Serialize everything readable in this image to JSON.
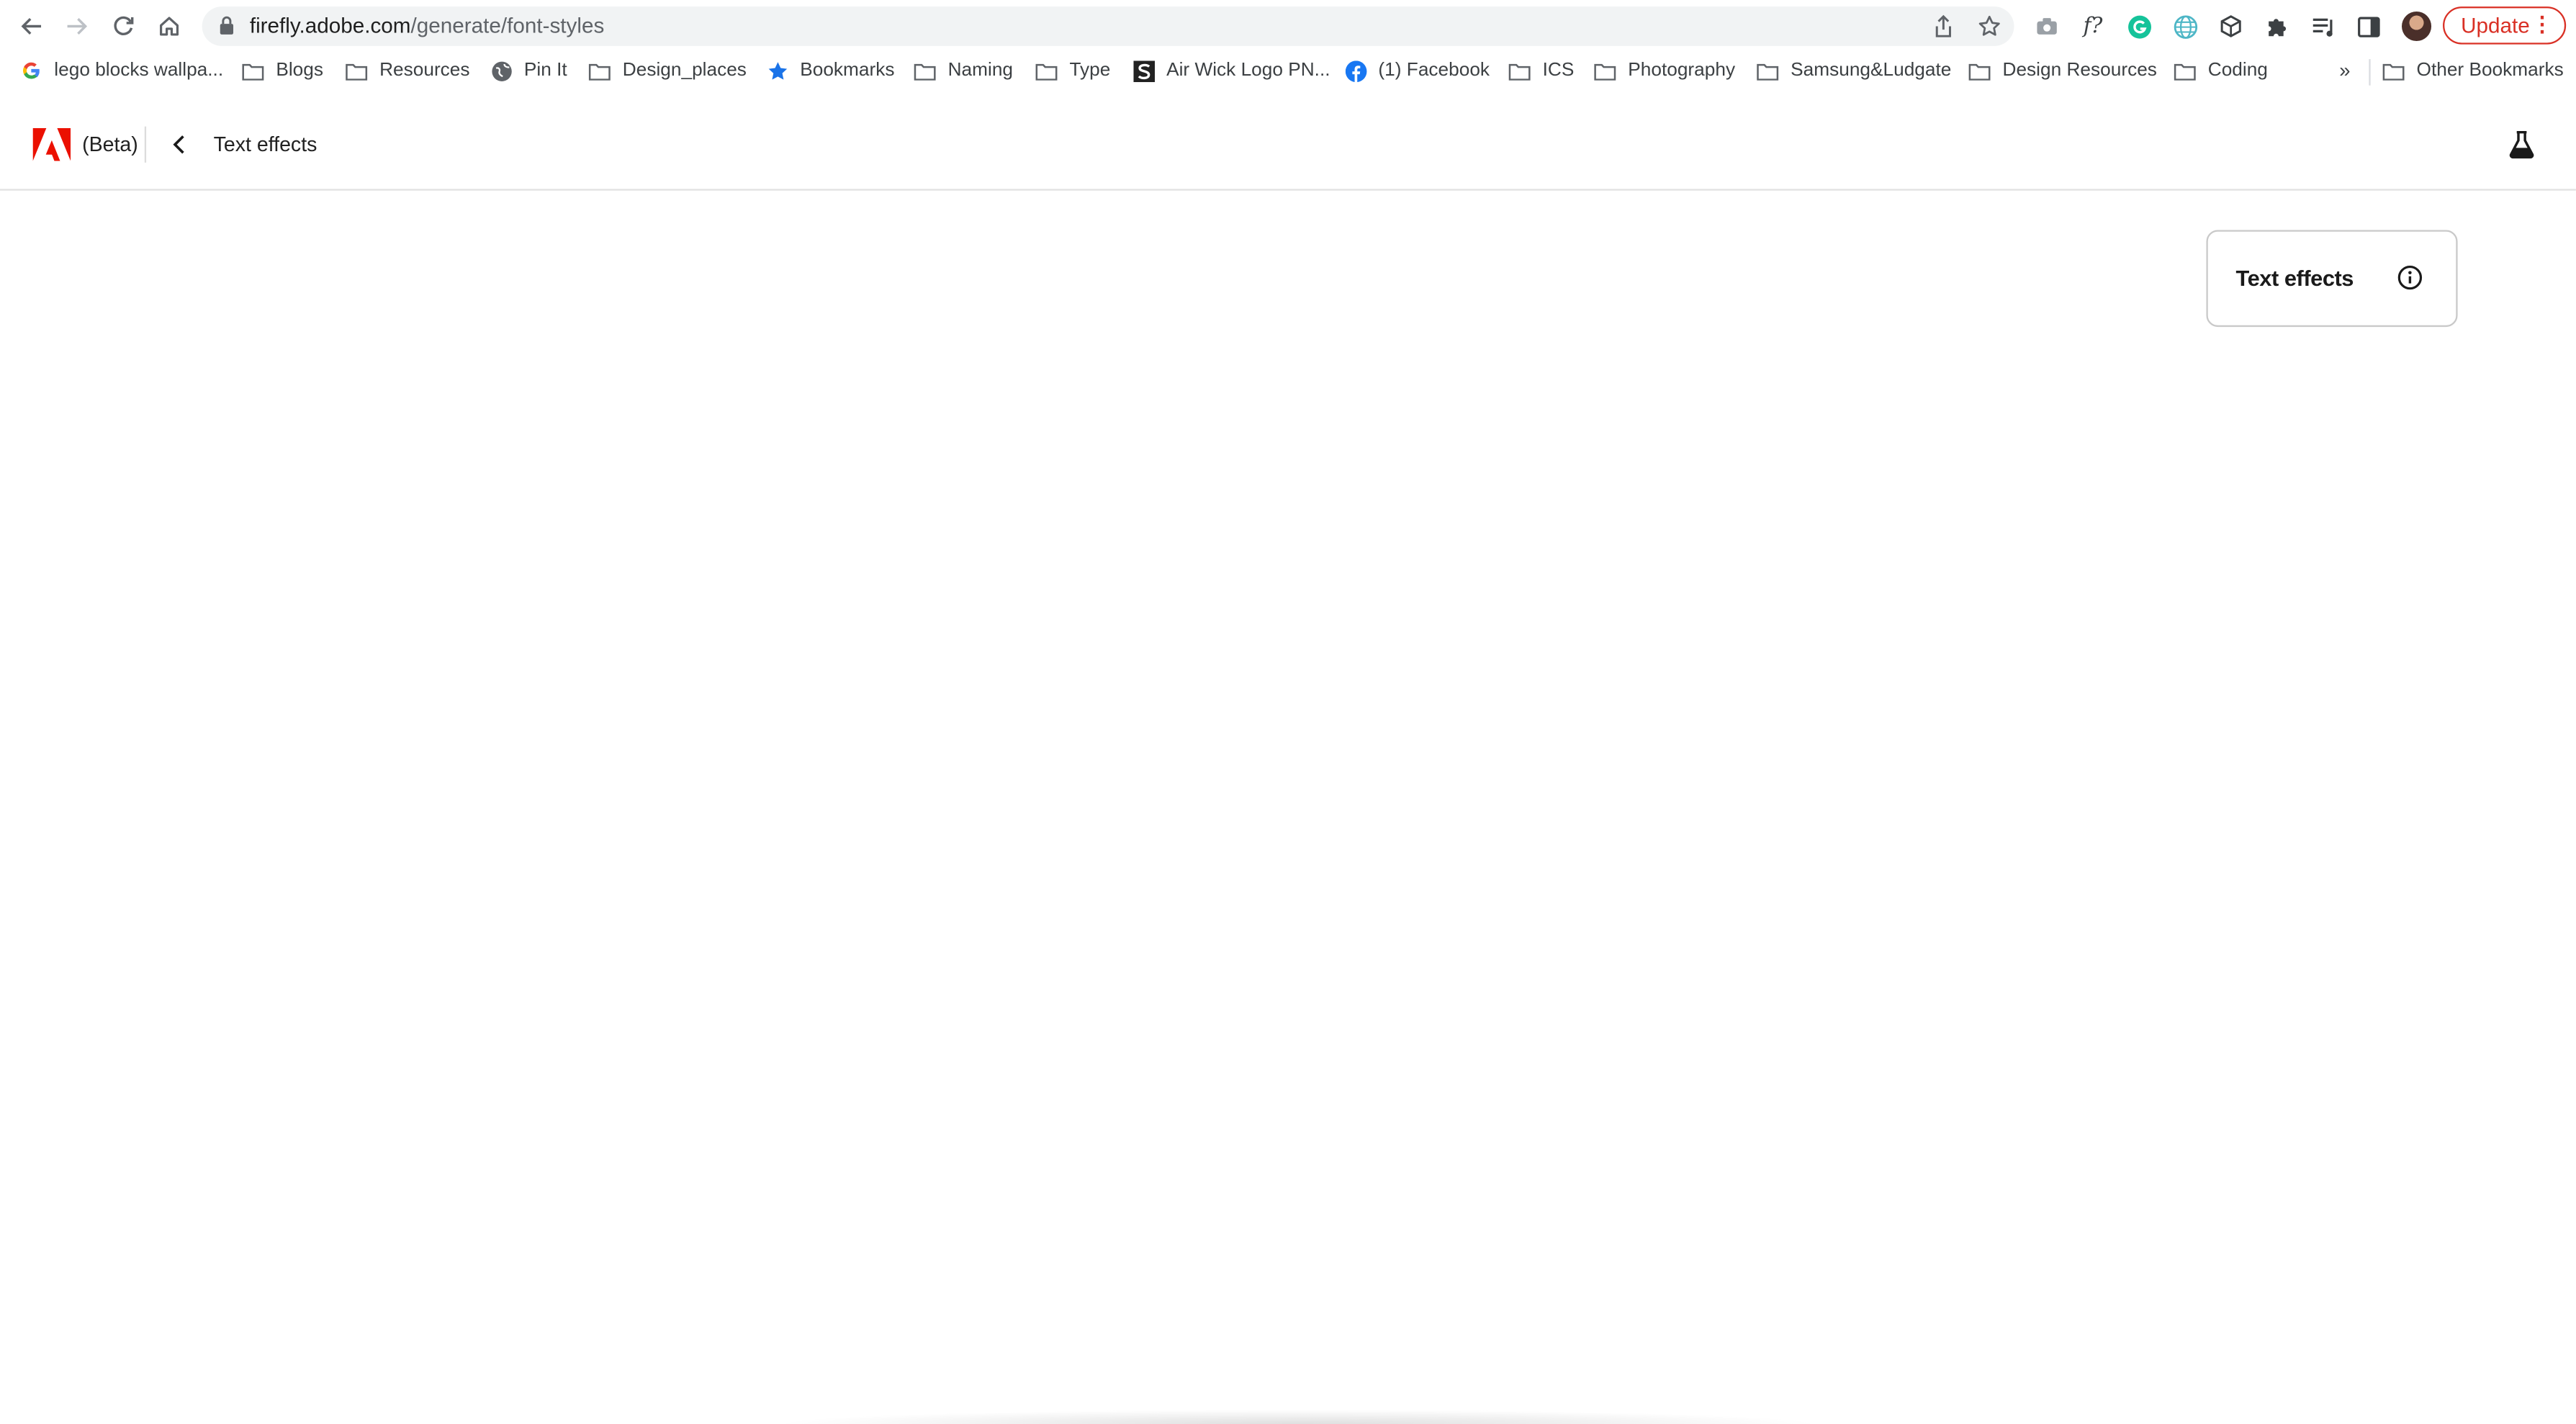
{
  "browser": {
    "url_host": "firefly.adobe.com",
    "url_path": "/generate/font-styles",
    "update_label": "Update",
    "more_bookmarks_glyph": "»"
  },
  "bookmarks": [
    {
      "label": "lego blocks wallpa...",
      "icon": "google-icon"
    },
    {
      "label": "Blogs",
      "icon": "folder-icon"
    },
    {
      "label": "Resources",
      "icon": "folder-icon"
    },
    {
      "label": "Pin It",
      "icon": "globe-icon"
    },
    {
      "label": "Design_places",
      "icon": "folder-icon"
    },
    {
      "label": "Bookmarks",
      "icon": "star-icon"
    },
    {
      "label": "Naming",
      "icon": "folder-icon"
    },
    {
      "label": "Type",
      "icon": "folder-icon"
    },
    {
      "label": "Air Wick Logo PN...",
      "icon": "s-logo-icon"
    },
    {
      "label": "(1) Facebook",
      "icon": "facebook-icon"
    },
    {
      "label": "ICS",
      "icon": "folder-icon"
    },
    {
      "label": "Photography",
      "icon": "folder-icon"
    },
    {
      "label": "Samsung&Ludgate",
      "icon": "folder-icon"
    },
    {
      "label": "Design Resources",
      "icon": "folder-icon"
    },
    {
      "label": "Coding",
      "icon": "folder-icon"
    }
  ],
  "other_bookmarks": "Other Bookmarks",
  "app": {
    "beta_label": "(Beta)",
    "breadcrumb": "Text effects",
    "panel_title": "Text effects"
  },
  "colors": {
    "adobe_red": "#eb1000",
    "update_red": "#d93025",
    "grammarly_green": "#15c39a",
    "facebook_blue": "#1877f2"
  }
}
